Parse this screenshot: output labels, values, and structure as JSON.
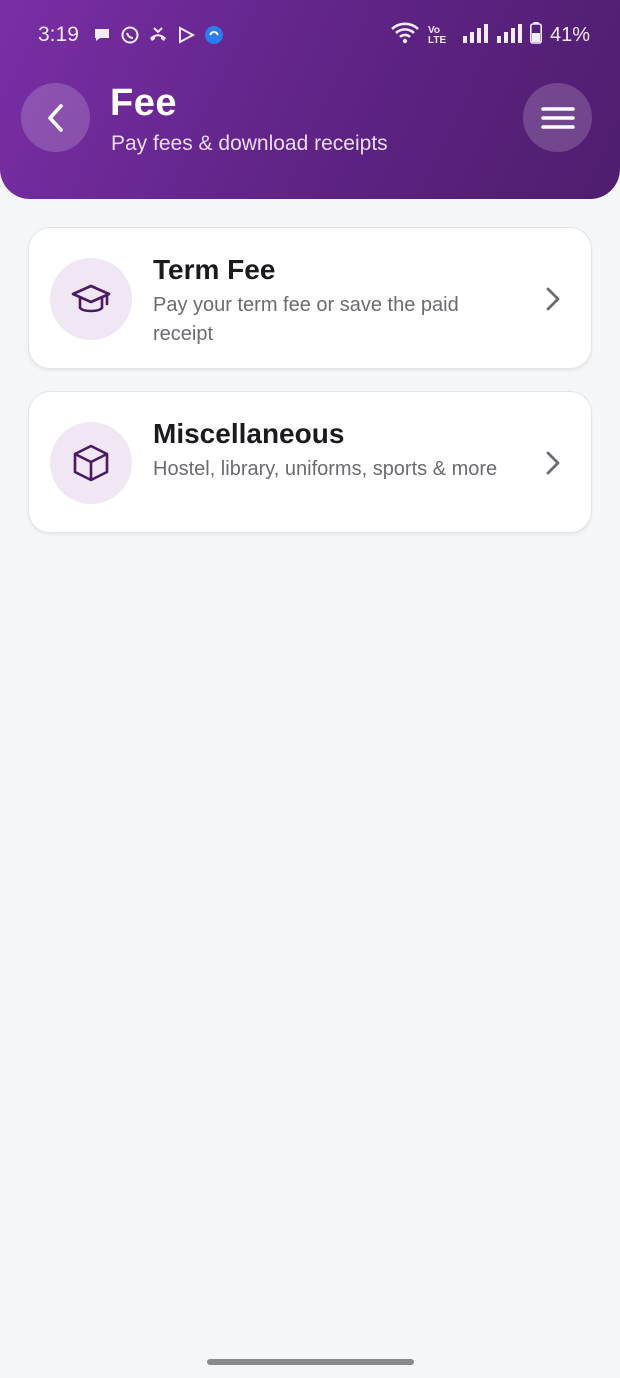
{
  "status_bar": {
    "time": "3:19",
    "network_label": "Vo LTE",
    "battery": "41%"
  },
  "header": {
    "title": "Fee",
    "subtitle": "Pay fees & download receipts"
  },
  "cards": [
    {
      "title": "Term Fee",
      "description": "Pay your term fee or save the paid receipt",
      "icon": "graduation-cap-icon"
    },
    {
      "title": "Miscellaneous",
      "description": "Hostel, library, uniforms, sports & more",
      "icon": "box-icon"
    }
  ],
  "colors": {
    "header_gradient_start": "#7a2ea6",
    "header_gradient_end": "#4f1d6f",
    "icon_bg": "#f0e6f4",
    "icon_stroke": "#4a1a66",
    "background": "#f5f6f8"
  }
}
